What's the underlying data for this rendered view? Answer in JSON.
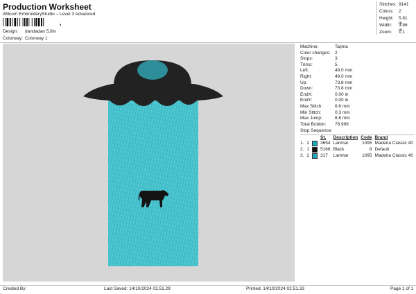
{
  "header": {
    "title": "Production Worksheet",
    "subtitle": "Wilcom EmbroideryStudio – Level 3 Advanced",
    "barcode_mark": ","
  },
  "meta": {
    "design_label": "Design:",
    "design_value": "dandadan 5,8in",
    "colorway_label": "Colorway:",
    "colorway_value": "Colorway 1"
  },
  "stats": [
    {
      "label": "Stitches:",
      "value": "9141"
    },
    {
      "label": "Colors:",
      "value": "2"
    },
    {
      "label": "Height:",
      "value": "5.81 in"
    },
    {
      "label": "Width:",
      "value": "3.86 in"
    },
    {
      "label": "Zoom:",
      "value": "1:1"
    }
  ],
  "machine_info": [
    {
      "label": "Machine:",
      "value": "Tajima"
    },
    {
      "label": "Color changes:",
      "value": "2"
    },
    {
      "label": "Stops:",
      "value": "3"
    },
    {
      "label": "Trims:",
      "value": "5"
    },
    {
      "label": "Left:",
      "value": "49.0 mm"
    },
    {
      "label": "Right:",
      "value": "49.0 mm"
    },
    {
      "label": "Up:",
      "value": "73.8 mm"
    },
    {
      "label": "Down:",
      "value": "73.8 mm"
    },
    {
      "label": "EndX:",
      "value": "0.00 in"
    },
    {
      "label": "EndY:",
      "value": "0.00 in"
    },
    {
      "label": "Max Stitch:",
      "value": "6.6 mm"
    },
    {
      "label": "Min Stitch:",
      "value": "0.3 mm"
    },
    {
      "label": "Max Jump:",
      "value": "6.6 mm"
    },
    {
      "label": "Total Bobbin:",
      "value": "78.99ft"
    }
  ],
  "stop_sequence": {
    "title": "Stop Sequence:",
    "headers": {
      "st": "St.",
      "description": "Description",
      "code": "Code",
      "brand": "Brand"
    },
    "rows": [
      {
        "index": "1.",
        "stop": "2",
        "color": "#1fa8b8",
        "st": "3654",
        "description": "Larimar",
        "code": "1095",
        "brand": "Madeira Classic 40"
      },
      {
        "index": "2.",
        "stop": "1",
        "color": "#111111",
        "st": "5168",
        "description": "Black",
        "code": "8",
        "brand": "Default"
      },
      {
        "index": "3.",
        "stop": "2",
        "color": "#1fa8b8",
        "st": "317",
        "description": "Larimar",
        "code": "1095",
        "brand": "Madeira Classic 40"
      }
    ]
  },
  "footer": {
    "created_by": "Created By:",
    "last_saved": "Last Saved: 14/10/2024 02.51.29",
    "printed": "Printed: 14/10/2024 02.51.33",
    "page": "Page 1 of 1"
  },
  "colors": {
    "teal": "#47c4cf",
    "black": "#1e1e1e",
    "preview_bg": "#d6d6d6"
  }
}
